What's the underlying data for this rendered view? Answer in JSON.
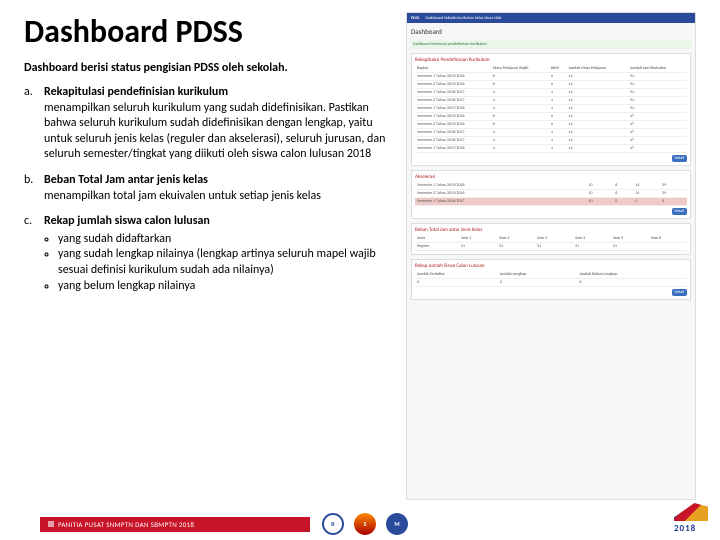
{
  "title": "Dashboard PDSS",
  "intro": "Dashboard berisi status pengisian PDSS oleh sekolah.",
  "items": [
    {
      "letter": "a.",
      "title": "Rekapitulasi pendefinisian kurikulum",
      "desc": "menampilkan seluruh kurikulum yang sudah didefinisikan. Pastikan bahwa seluruh kurikulum sudah didefinisikan dengan lengkap, yaitu untuk seluruh jenis kelas (reguler dan akselerasi), seluruh jurusan, dan seluruh semester/tingkat yang diikuti oleh siswa calon lulusan 2018",
      "bullets": []
    },
    {
      "letter": "b.",
      "title": "Beban Total Jam antar jenis kelas",
      "desc": "menampilkan total jam ekuivalen untuk setiap jenis kelas",
      "bullets": []
    },
    {
      "letter": "c.",
      "title": "Rekap jumlah siswa calon lulusan",
      "desc": "",
      "bullets": [
        "yang sudah didaftarkan",
        "yang sudah lengkap nilainya (lengkap artinya seluruh mapel wajib sesuai definisi kurikulum sudah ada nilainya)",
        "yang belum lengkap nilainya"
      ]
    }
  ],
  "footer": {
    "banner": "PANITIA PUSAT SNMPTN DAN SBMPTN 2018",
    "year": "2018"
  },
  "screenshot": {
    "nav": {
      "brand": "PDSS",
      "items": [
        "Dashboard",
        "Sekolah",
        "Kurikulum",
        "Kelas",
        "Siswa",
        "Nilai"
      ]
    },
    "heading": "Dashboard",
    "notice": "Dashboard informasi pendefinisian kurikulum",
    "cards": [
      {
        "title": "Rekapitulasi Pendefinisian Kurikulum",
        "headers": [
          "Bagian",
          "Mata Pelajaran Wajib",
          "KKM",
          "Jumlah Mata Pelajaran",
          "Jumlah Jam Ekuivalen"
        ],
        "rows": [
          [
            "Semester 1 Tahun 2015/2016",
            "6",
            "6",
            "14",
            "51"
          ],
          [
            "Semester 2 Tahun 2015/2016",
            "6",
            "6",
            "14",
            "51"
          ],
          [
            "Semester 1 Tahun 2016/2017",
            "4",
            "4",
            "14",
            "51"
          ],
          [
            "Semester 2 Tahun 2016/2017",
            "4",
            "4",
            "14",
            "51"
          ],
          [
            "Semester 1 Tahun 2017/2018",
            "4",
            "4",
            "14",
            "51"
          ],
          [
            "Semester 1 Tahun 2015/2016",
            "6",
            "6",
            "14",
            "47"
          ],
          [
            "Semester 2 Tahun 2015/2016",
            "6",
            "6",
            "14",
            "47"
          ],
          [
            "Semester 1 Tahun 2016/2017",
            "4",
            "4",
            "14",
            "47"
          ],
          [
            "Semester 2 Tahun 2016/2017",
            "4",
            "4",
            "14",
            "47"
          ],
          [
            "Semester 1 Tahun 2017/2018",
            "4",
            "4",
            "14",
            "47"
          ]
        ],
        "btn": "Detail"
      },
      {
        "title": "Akselerasi",
        "headers": [
          "",
          "",
          "",
          "",
          ""
        ],
        "rows": [
          [
            "Semester 1 Tahun 2015/2016",
            "10",
            "6",
            "14",
            "59"
          ],
          [
            "Semester 2 Tahun 2015/2016",
            "10",
            "6",
            "14",
            "59"
          ],
          [
            "Semester 1 Tahun 2016/2017",
            "10",
            "0",
            "0",
            "0"
          ]
        ],
        "redRow": 2,
        "btn": "Detail"
      },
      {
        "title": "Beban Total Jam antar Jenis Kelas",
        "headers": [
          "Jenis",
          "Sem 1",
          "Sem 2",
          "Sem 3",
          "Sem 4",
          "Sem 5",
          "Sem 6"
        ],
        "rows": [
          [
            "Reguler",
            "51",
            "51",
            "51",
            "51",
            "51",
            ""
          ]
        ],
        "btn": ""
      },
      {
        "title": "Rekap Jumlah Siswa Calon Lulusan",
        "headers": [
          "Jumlah Terdaftar",
          "Jumlah Lengkap",
          "Jumlah Belum Lengkap"
        ],
        "rows": [
          [
            "6",
            "0",
            "6"
          ]
        ],
        "btn": "Detail"
      }
    ]
  }
}
